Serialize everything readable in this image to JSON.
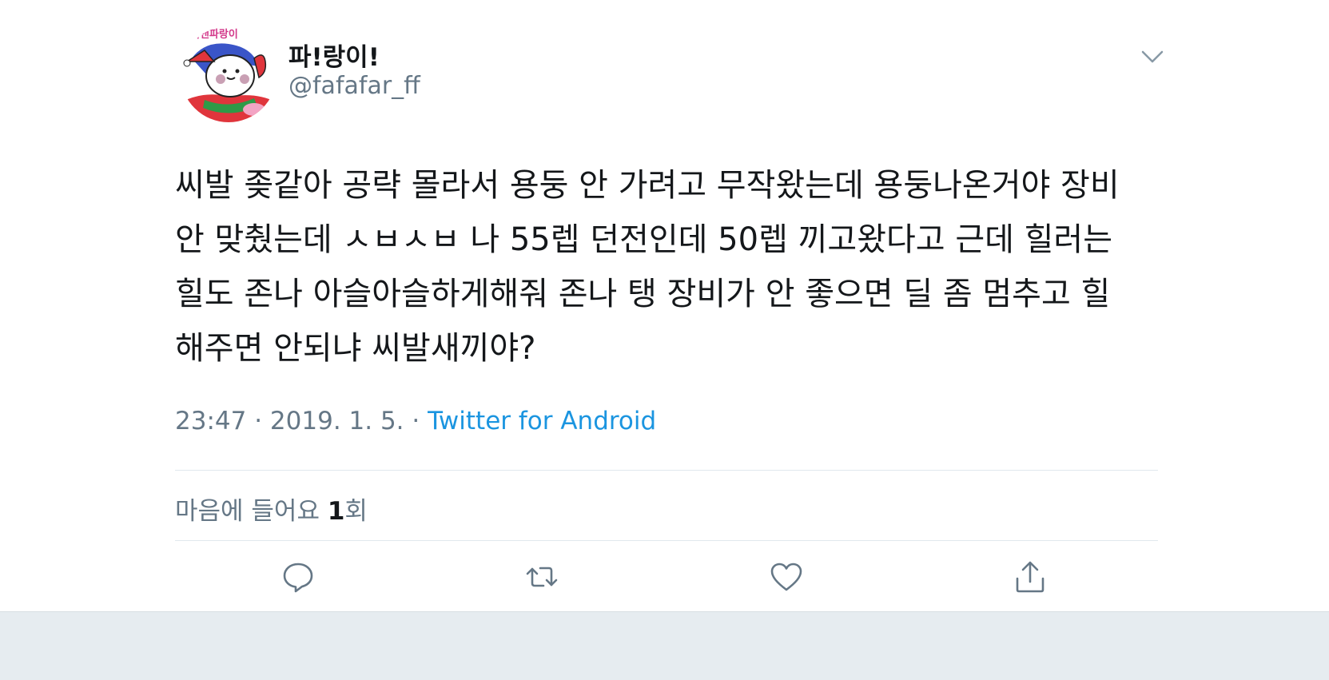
{
  "author": {
    "display_name": "파!랑이!",
    "handle": "@fafafar_ff",
    "avatar_text": "석앤파랑이"
  },
  "tweet": {
    "text": "씨발 좆같아 공략 몰라서 용둥 안 가려고 무작왔는데 용둥나온거야 장비 안 맞췄는데 ㅅㅂㅅㅂ 나 55렙 던전인데 50렙 끼고왔다고 근데 힐러는 힐도 존나 아슬아슬하게해줘 존나 탱 장비가 안 좋으면 딜 좀 멈추고 힐 해주면 안되냐 씨발새끼야?",
    "time": "23:47",
    "date": "2019. 1. 5.",
    "separator": "·",
    "source": "Twitter for Android"
  },
  "stats": {
    "likes_label": "마음에 들어요",
    "likes_count": "1",
    "likes_unit": "회"
  },
  "actions": {
    "reply_icon": "reply-icon",
    "retweet_icon": "retweet-icon",
    "like_icon": "heart-icon",
    "share_icon": "share-icon"
  },
  "colors": {
    "text": "#14171a",
    "muted": "#657786",
    "link": "#1b95e0",
    "divider": "#e1e8ed",
    "footer_bg": "#e6ecf0"
  }
}
